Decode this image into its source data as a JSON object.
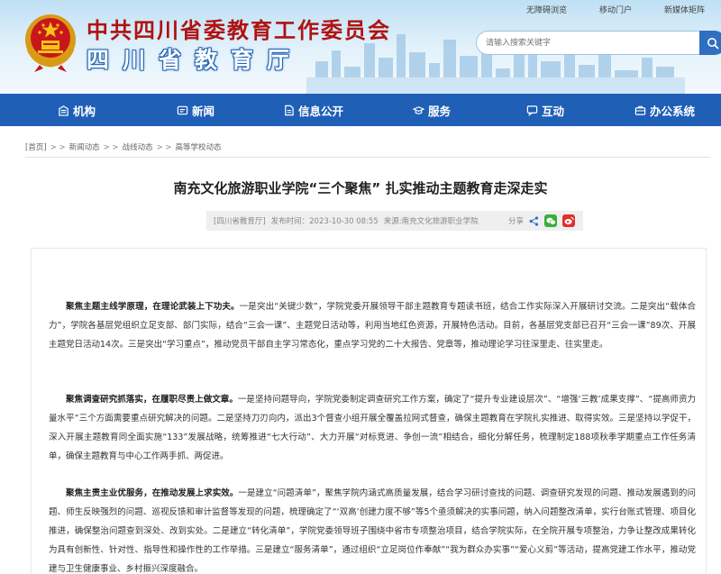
{
  "header": {
    "title": "中共四川省委教育工作委员会",
    "subtitle": "四川省教育厅",
    "top_links": [
      "无障碍浏览",
      "移动门户",
      "新媒体矩阵"
    ],
    "search_placeholder": "请输入搜索关键字"
  },
  "nav": {
    "items": [
      {
        "label": "机构",
        "icon": "building-icon"
      },
      {
        "label": "新闻",
        "icon": "news-icon"
      },
      {
        "label": "信息公开",
        "icon": "document-icon"
      },
      {
        "label": "服务",
        "icon": "mortarboard-icon"
      },
      {
        "label": "互动",
        "icon": "chat-icon"
      },
      {
        "label": "办公系统",
        "icon": "briefcase-icon"
      }
    ]
  },
  "breadcrumb": {
    "items": [
      "[首页]",
      "新闻动态",
      "战线动态",
      "高等学校动态"
    ],
    "sep": "> >"
  },
  "article": {
    "title": "南充文化旅游职业学院“三个聚焦” 扎实推动主题教育走深走实",
    "source_label": "[四川省教育厅]",
    "date": "发布时间：2023-10-30 08:55",
    "origin": "来源:南充文化旅游职业学院",
    "share_label": "分享",
    "paragraphs": [
      {
        "lead": "聚焦主题主线学原理，在理论武装上下功夫。",
        "text": "一是突出“关键少数”，学院党委开展领导干部主题教育专题读书班，结合工作实际深入开展研讨交流。二是突出“载体合力”，学院各基层党组织立足支部、部门实际，结合“三会一课”、主题党日活动等，利用当地红色资源，开展特色活动。目前，各基层党支部已召开“三会一课”89次、开展主题党日活动14次。三是突出“学习重点”，推动党员干部自主学习常态化，重点学习党的二十大报告、党章等，推动理论学习往深里走、往实里走。"
      },
      {
        "lead": "聚焦调查研究抓落实，在履职尽责上做文章。",
        "text": "一是坚持问题导向，学院党委制定调查研究工作方案，确定了“提升专业建设层次”、“增强‘三教’成果支撑”、“提高师资力量水平”三个方面需要重点研究解决的问题。二是坚持刀刃向内，派出3个督查小组开展全覆盖拉网式督查，确保主题教育在学院扎实推进、取得实效。三是坚持以学促干，深入开展主题教育同全面实施“133”发展战略，统筹推进“七大行动”、大力开展“对标竞进、争创一流”相结合，细化分解任务，梳理制定188项秋季学期重点工作任务清单，确保主题教育与中心工作两手抓、两促进。"
      },
      {
        "lead": "聚焦主责主业优服务，在推动发展上求实效。",
        "text": "一是建立“问题清单”，聚焦学院内涵式高质量发展，结合学习研讨查找的问题、调查研究发现的问题、推动发展遇到的问题、师生反映强烈的问题、巡视反馈和审计监督等发现的问题，梳理确定了“‘双高’创建力度不够”等5个亟须解决的实事问题，纳入问题整改清单，实行台账式管理、项目化推进，确保整治问题查到深处、改到实处。二是建立“转化清单”，学院党委领导班子围绕中省市专项整治项目，结合学院实际，在全院开展专项整治，力争让整改成果转化为具有创新性、针对性、指导性和操作性的工作举措。三是建立“服务清单”，通过组织“立足岗位作奉献”“我为群众办实事”“爱心义剪”等活动，提高党建工作水平，推动党建与卫生健康事业、乡村振兴深度融合。"
      }
    ]
  },
  "colors": {
    "nav_bg": "#1f5fb6",
    "title_red": "#b01212",
    "wechat_green": "#35b03a",
    "weibo_red": "#e0302d"
  }
}
